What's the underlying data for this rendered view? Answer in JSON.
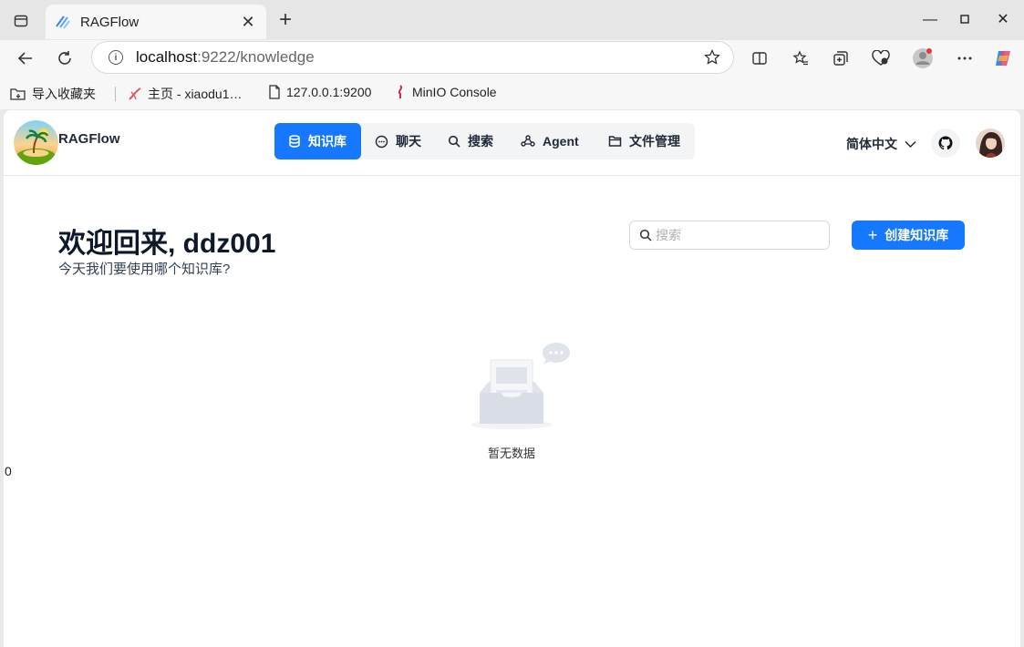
{
  "browser": {
    "tab_title": "RAGFlow",
    "url_host": "localhost",
    "url_path": ":9222/knowledge",
    "bookmarks": [
      {
        "label": "导入收藏夹",
        "icon": "import-folder-icon"
      },
      {
        "label": "主页 - xiaodu1…",
        "icon": "site-favicon"
      },
      {
        "label": "127.0.0.1:9200",
        "icon": "page-icon"
      },
      {
        "label": "MinIO Console",
        "icon": "minio-icon"
      }
    ]
  },
  "app": {
    "brand": "RAGFlow",
    "nav": [
      {
        "label": "知识库",
        "icon": "database-icon",
        "active": true
      },
      {
        "label": "聊天",
        "icon": "chat-icon",
        "active": false
      },
      {
        "label": "搜索",
        "icon": "search-icon",
        "active": false
      },
      {
        "label": "Agent",
        "icon": "agent-icon",
        "active": false
      },
      {
        "label": "文件管理",
        "icon": "folder-icon",
        "active": false
      }
    ],
    "language": "简体中文"
  },
  "main": {
    "welcome": "欢迎回来, ddz001",
    "subtitle": "今天我们要使用哪个知识库?",
    "search_placeholder": "搜索",
    "create_label": "创建知识库",
    "empty_text": "暂无数据",
    "count_text": "0"
  },
  "colors": {
    "primary": "#1677ff"
  }
}
